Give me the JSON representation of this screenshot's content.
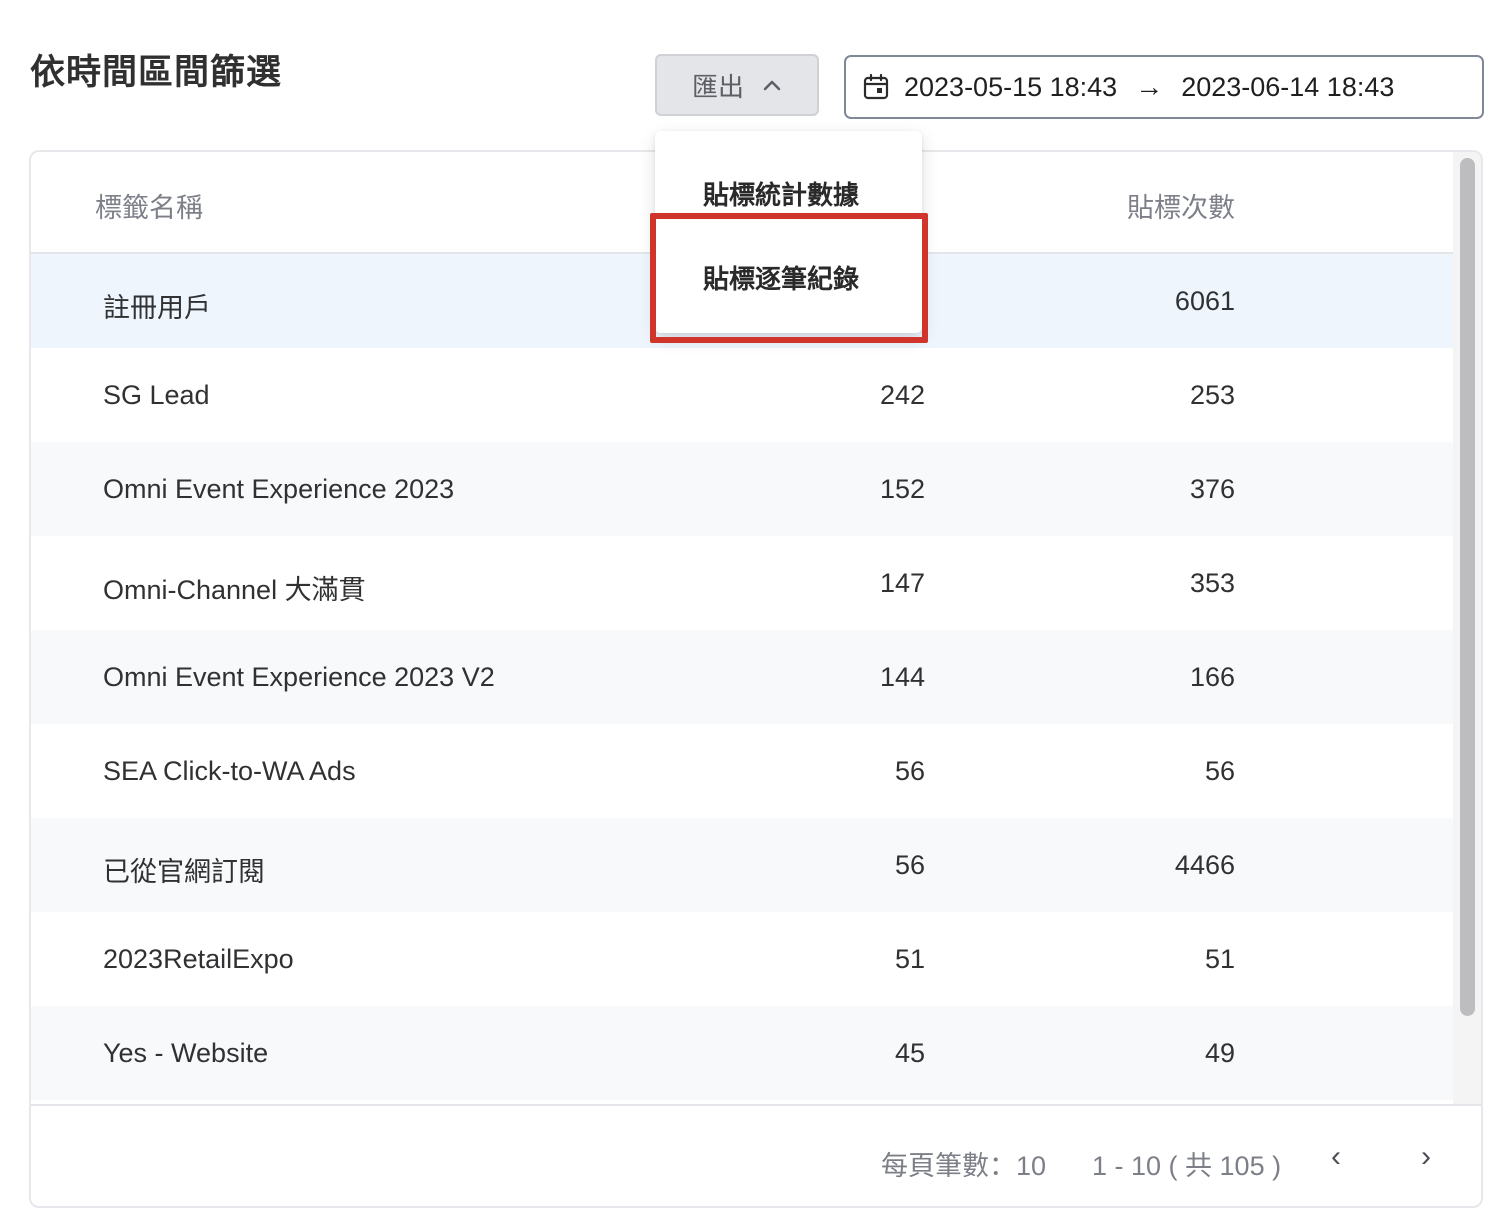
{
  "header": {
    "title": "依時間區間篩選",
    "export_label": "匯出",
    "date_start": "2023-05-15 18:43",
    "date_arrow": "→",
    "date_end": "2023-06-14 18:43"
  },
  "export_menu": {
    "items": [
      {
        "label": "貼標統計數據"
      },
      {
        "label": "貼標逐筆紀錄"
      }
    ],
    "highlighted_item": "貼標逐筆紀錄",
    "highlight_color": "#d0352b"
  },
  "table": {
    "columns": [
      "標籤名稱",
      "貼標次數"
    ],
    "rows": [
      {
        "name": "註冊用戶",
        "count": "",
        "times": "6061"
      },
      {
        "name": "SG Lead",
        "count": "242",
        "times": "253"
      },
      {
        "name": "Omni Event Experience 2023",
        "count": "152",
        "times": "376"
      },
      {
        "name": "Omni-Channel 大滿貫",
        "count": "147",
        "times": "353"
      },
      {
        "name": "Omni Event Experience 2023 V2",
        "count": "144",
        "times": "166"
      },
      {
        "name": "SEA Click-to-WA Ads",
        "count": "56",
        "times": "56"
      },
      {
        "name": "已從官網訂閱",
        "count": "56",
        "times": "4466"
      },
      {
        "name": "2023RetailExpo",
        "count": "51",
        "times": "51"
      },
      {
        "name": "Yes - Website",
        "count": "45",
        "times": "49"
      }
    ]
  },
  "pagination": {
    "rows_per_page": "每頁筆數：10",
    "range": "1 - 10 ( 共 105 )",
    "prev_icon": "‹",
    "next_icon": "›"
  },
  "colors": {
    "row_highlight": "#eef5fd",
    "row_alt": "#f8f9fb"
  }
}
